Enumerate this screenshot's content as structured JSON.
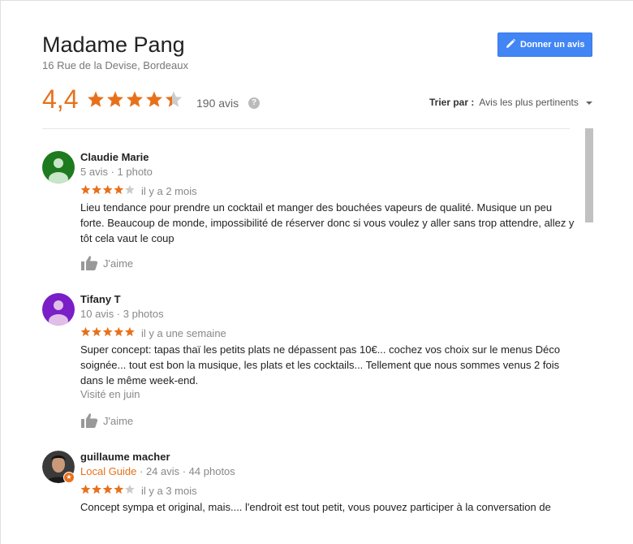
{
  "place": {
    "name": "Madame Pang",
    "address": "16 Rue de la Devise, Bordeaux"
  },
  "header": {
    "write_review_label": "Donner un avis",
    "rating": "4,4",
    "rating_value": 4.4,
    "review_count": "190 avis",
    "help_glyph": "?",
    "sort_label": "Trier par :",
    "sort_value": "Avis les plus pertinents"
  },
  "colors": {
    "accent": "#e7711b",
    "button": "#4285f4"
  },
  "reviews": [
    {
      "name": "Claudie Marie",
      "meta": "5 avis · 1 photo",
      "stars": 4,
      "time": "il y a 2 mois",
      "text": "Lieu tendance pour prendre un cocktail et manger des bouchées vapeurs de qualité. Musique un peu forte. Beaucoup de monde, impossibilité de réserver donc si vous voulez y aller sans trop attendre, allez y tôt cela vaut le coup",
      "like_label": "J'aime",
      "avatar_color": "#1e7a1e"
    },
    {
      "name": "Tifany T",
      "meta": "10 avis · 3 photos",
      "stars": 5,
      "time": "il y a une semaine",
      "text": "Super concept: tapas thaï les petits plats ne dépassent pas 10€... cochez vos choix sur le menus Déco soignée... tout est bon la musique, les plats et les cocktails... Tellement que nous sommes venus 2 fois dans le même week-end.",
      "visited": "Visité en juin",
      "like_label": "J'aime",
      "avatar_color": "#7a1ec8"
    },
    {
      "name": "guillaume macher",
      "guide_label": "Local Guide",
      "meta": " · 24 avis · 44 photos",
      "stars": 4,
      "time": "il y a 3 mois",
      "text": "Concept sympa et original, mais.... l'endroit est tout petit, vous pouvez participer à la conversation de"
    }
  ]
}
